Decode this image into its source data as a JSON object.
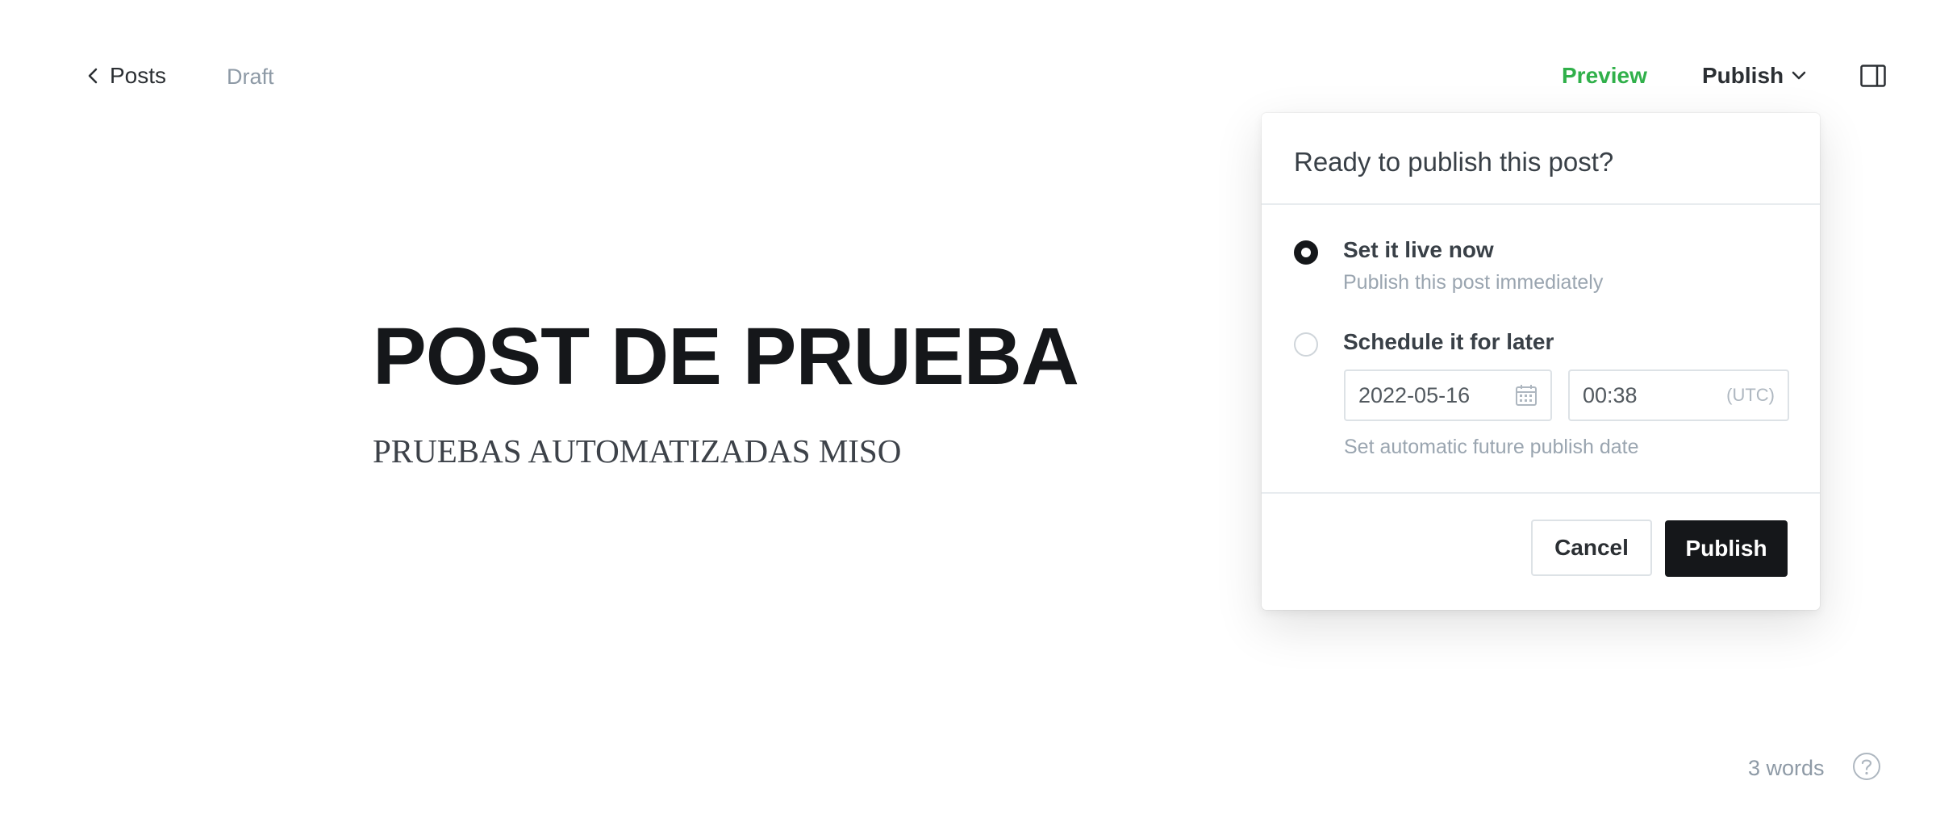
{
  "header": {
    "back_label": "Posts",
    "status": "Draft",
    "preview_label": "Preview",
    "publish_label": "Publish",
    "back_icon": "chevron-left-icon",
    "publish_icon": "chevron-down-icon",
    "sidebar_icon": "sidebar-toggle-icon"
  },
  "editor": {
    "title": "POST DE PRUEBA",
    "excerpt": "PRUEBAS AUTOMATIZADAS MISO"
  },
  "publish_menu": {
    "heading": "Ready to publish this post?",
    "options": [
      {
        "label": "Set it live now",
        "sub": "Publish this post immediately",
        "selected": true
      },
      {
        "label": "Schedule it for later",
        "selected": false
      }
    ],
    "date_value": "2022-05-16",
    "time_value": "00:38",
    "timezone": "(UTC)",
    "schedule_help": "Set automatic future publish date",
    "cancel_label": "Cancel",
    "confirm_label": "Publish",
    "calendar_icon": "calendar-icon"
  },
  "footer": {
    "word_count": "3 words",
    "help_icon": "help-icon"
  },
  "colors": {
    "accent_green": "#30b04a",
    "primary_dark": "#15171a",
    "muted": "#8e9aa6"
  }
}
